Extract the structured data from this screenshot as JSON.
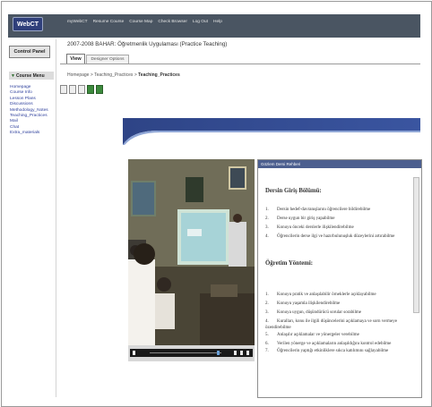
{
  "logo": "WebCT",
  "topnav": [
    "myWebCT",
    "Resume Course",
    "Course Map",
    "Check Browser",
    "Log Out",
    "Help"
  ],
  "control_panel": "Control Panel",
  "course_title": "2007-2008 BAHAR: Öğretmenlik Uygulaması (Practice Teaching)",
  "tabs": {
    "view": "View",
    "designer": "Designer Options"
  },
  "course_menu": {
    "title": "Course Menu",
    "items": [
      "Homepage",
      "Course Info",
      "Lesson Plans",
      "Discussions",
      "Methodology_Notes",
      "Teaching_Practices",
      "Mail",
      "Chat",
      "Extra_materials"
    ]
  },
  "breadcrumb": {
    "path": "Homepage > Teaching_Practices > ",
    "current": "Teaching_Practices"
  },
  "panel": {
    "header": "Gözlem Dersi Rehberi",
    "section1_title": "Dersin Giriş Bölümü:",
    "section1_items": [
      "Dersin hedef-davranışlarını öğrencilere bildirebilme",
      "Derse uygun bir giriş yapabilme",
      "Konuyu önceki derslerle ilişkilendirebilme",
      "Öğrencilerin derse ilgi ve hazırbulunuşluk düzeylerini artırabilme"
    ],
    "section2_title": "Öğretim Yöntemi:",
    "section2_items": [
      "Konuyu pratik ve anlaşılabilir örneklerle açıklayabilme",
      "Konuyu yaşamla ilişkilendirebilme",
      "Konuya uygun, düşündürücü sorular sorabilme",
      "Kuralları, konu ile ilgili düşüncelerini açıklamaya ve sorn vermeye özendirebilme",
      "Anlaşılır açıklamalar ve yönergeler verebilme",
      "Verilen yönerge ve açıklamaların anlaşıldığını kontrol edebilme",
      "Öğrencilerin yaptığı etkinliklere sıkca katılımını sağlayabilme"
    ]
  },
  "colors": {
    "topbar": "#4a5562",
    "banner": "#2e4486",
    "panel_header": "#4c5f8f",
    "menu_link": "#2c3e9b"
  }
}
